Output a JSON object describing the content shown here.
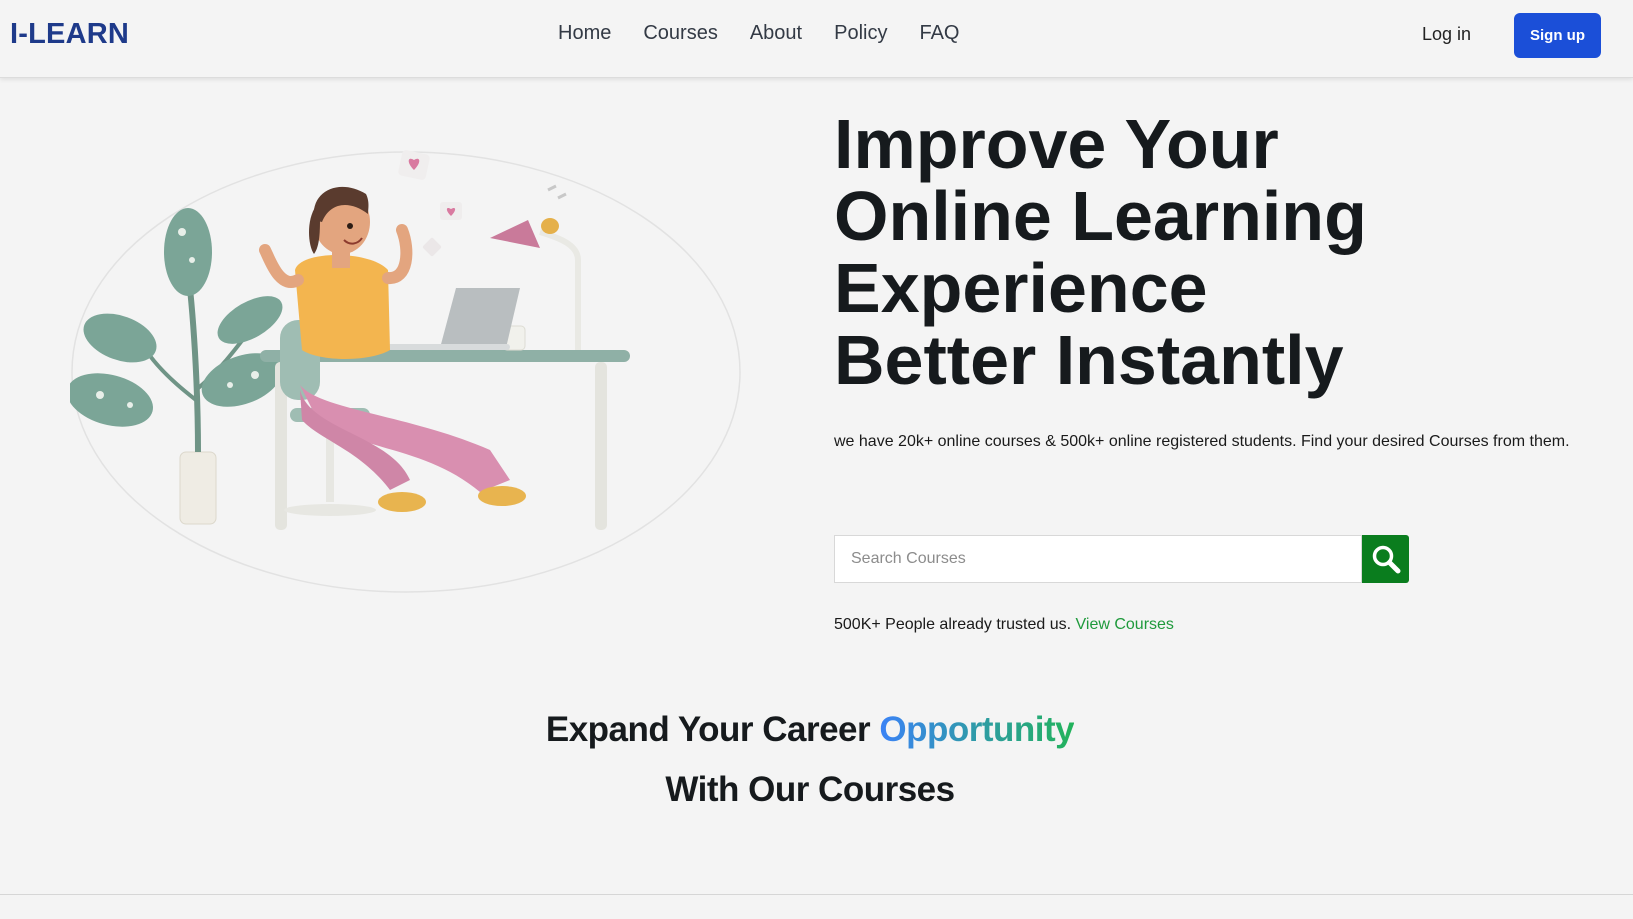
{
  "nav": {
    "brand": "I-LEARN",
    "links": [
      "Home",
      "Courses",
      "About",
      "Policy",
      "FAQ"
    ],
    "login": "Log in",
    "signup": "Sign up"
  },
  "hero": {
    "title_lines": [
      "Improve Your",
      "Online Learning",
      "Experience",
      "Better Instantly"
    ],
    "description": "we have 20k+ online courses & 500k+ online registered students. Find your desired Courses from them.",
    "search": {
      "placeholder": "Search Courses",
      "value": ""
    },
    "trust_text": "500K+ People already trusted us.",
    "trust_link": "View Courses"
  },
  "section": {
    "title_part1": "Expand Your Career",
    "title_highlight": "Opportunity",
    "title_line2": "With Our Courses"
  },
  "colors": {
    "brand": "#1e3a8a",
    "signup_bg": "#1b4fd8",
    "search_button": "#0a7d1e",
    "link_green": "#1f9a3c"
  },
  "icons": {
    "search": "search-icon"
  }
}
